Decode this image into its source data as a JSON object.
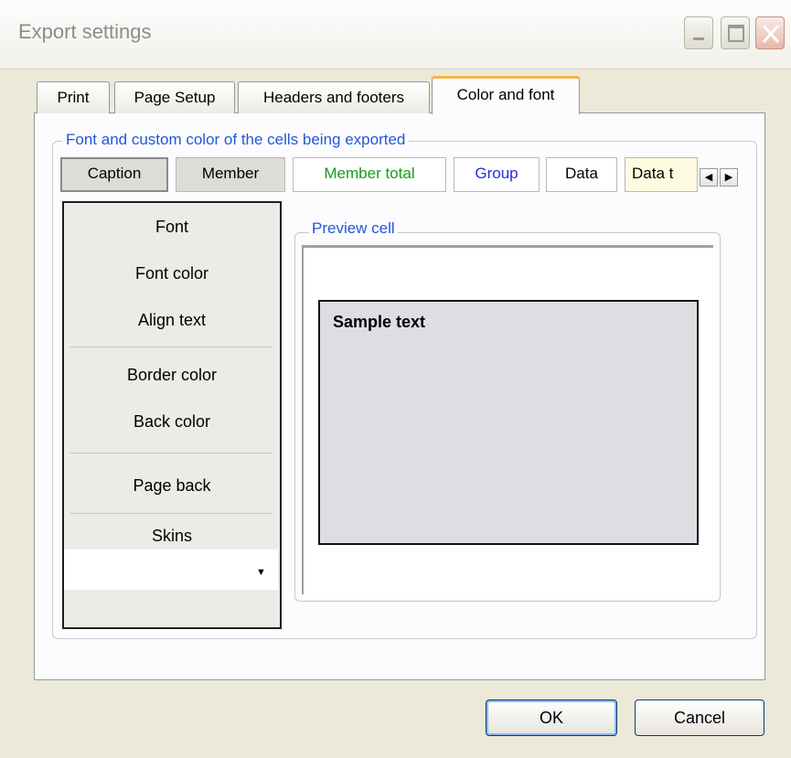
{
  "window": {
    "title": "Export settings"
  },
  "tabs": [
    {
      "label": "Print"
    },
    {
      "label": "Page Setup"
    },
    {
      "label": "Headers and footers"
    },
    {
      "label": "Color and font",
      "active": true
    }
  ],
  "group": {
    "legend": "Font and custom color of the cells being exported",
    "cell_tabs": [
      {
        "label": "Caption",
        "selected": true
      },
      {
        "label": "Member"
      },
      {
        "label": "Member total",
        "color": "#1a9a1a"
      },
      {
        "label": "Group",
        "color": "#2030d8"
      },
      {
        "label": "Data"
      },
      {
        "label": "Data t"
      }
    ]
  },
  "settings": {
    "font": "Font",
    "font_color": "Font color",
    "align_text": "Align text",
    "border_color": "Border color",
    "back_color": "Back color",
    "page_back": "Page back",
    "skins": "Skins",
    "skins_value": ""
  },
  "preview": {
    "legend": "Preview cell",
    "sample_text": "Sample text"
  },
  "buttons": {
    "ok": "OK",
    "cancel": "Cancel"
  },
  "colors": {
    "accent": "#2058d8",
    "active_tab": "#f5b443"
  }
}
